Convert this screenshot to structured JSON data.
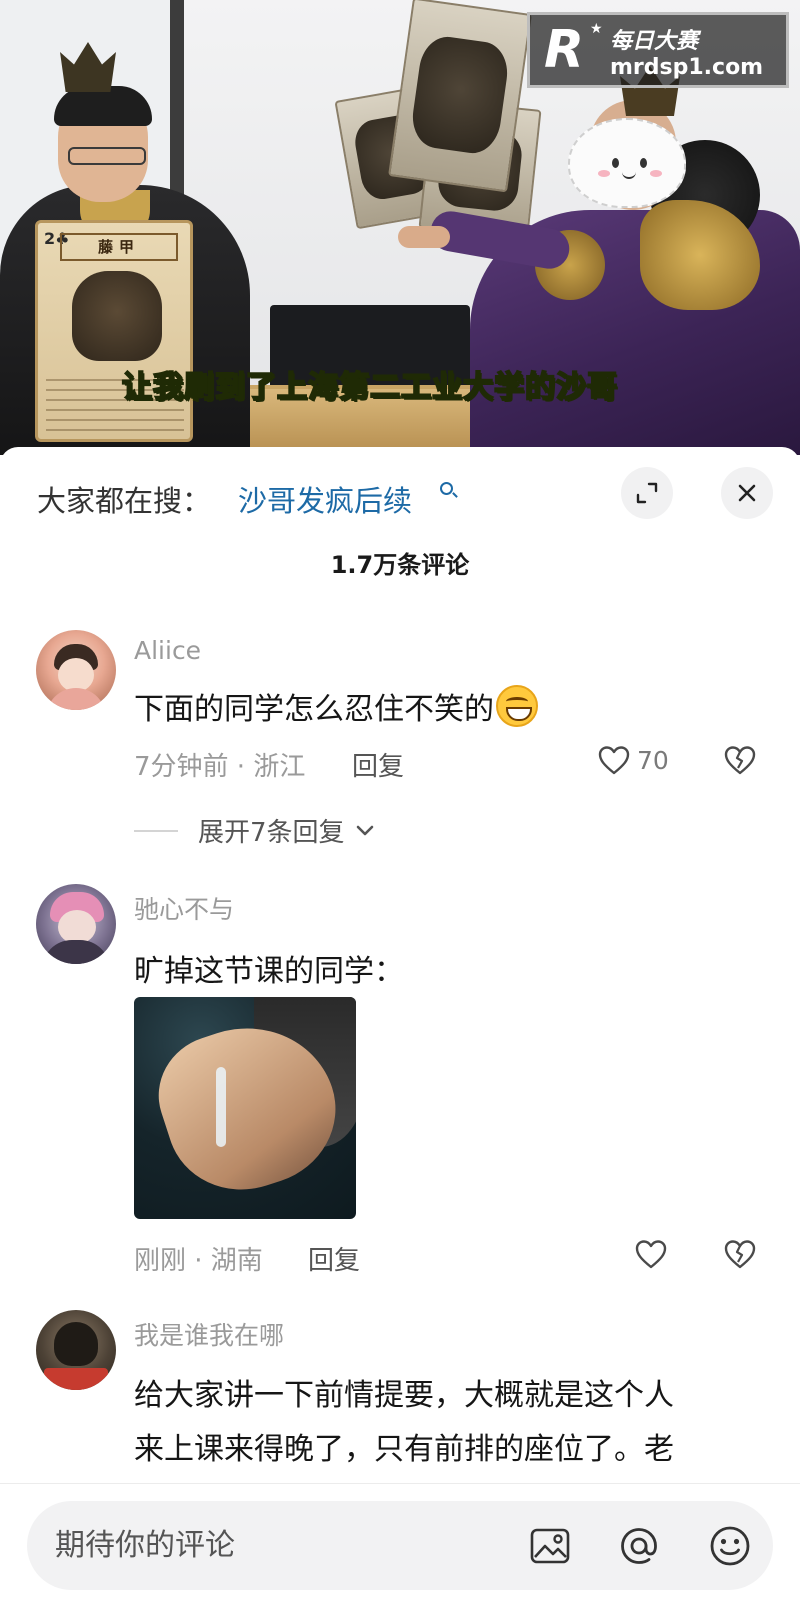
{
  "video": {
    "caption": "让我刷到了上海第二工业大学的沙哥",
    "card": {
      "title": "藤甲",
      "number": "2♣"
    },
    "watermark": {
      "logo": "R",
      "name": "每日大赛",
      "url": "mrdsp1.com"
    }
  },
  "header": {
    "hot_prefix": "大家都在搜：",
    "hot_link": "沙哥发疯后续",
    "comment_count": "1.7万条评论"
  },
  "comments": [
    {
      "user": "Aliice",
      "text": "下面的同学怎么忍住不笑的",
      "emoji": "grinning-face",
      "meta": "7分钟前 · 浙江",
      "reply_label": "回复",
      "likes": "70",
      "expand": "展开7条回复"
    },
    {
      "user": "驰心不与",
      "text": "旷掉这节课的同学：",
      "meta": "刚刚 · 湖南",
      "reply_label": "回复",
      "likes": ""
    },
    {
      "user": "我是谁我在哪",
      "text_line1": "给大家讲一下前情提要，大概就是这个人",
      "text_line2": "来上课来得晚了，只有前排的座位了。老"
    }
  ],
  "input": {
    "placeholder": "期待你的评论",
    "icons": [
      "image-icon",
      "at-icon",
      "emoji-icon"
    ]
  },
  "colors": {
    "link": "#1d6aa6",
    "caption": "#d8ff3b",
    "muted": "#9a9a9a"
  }
}
